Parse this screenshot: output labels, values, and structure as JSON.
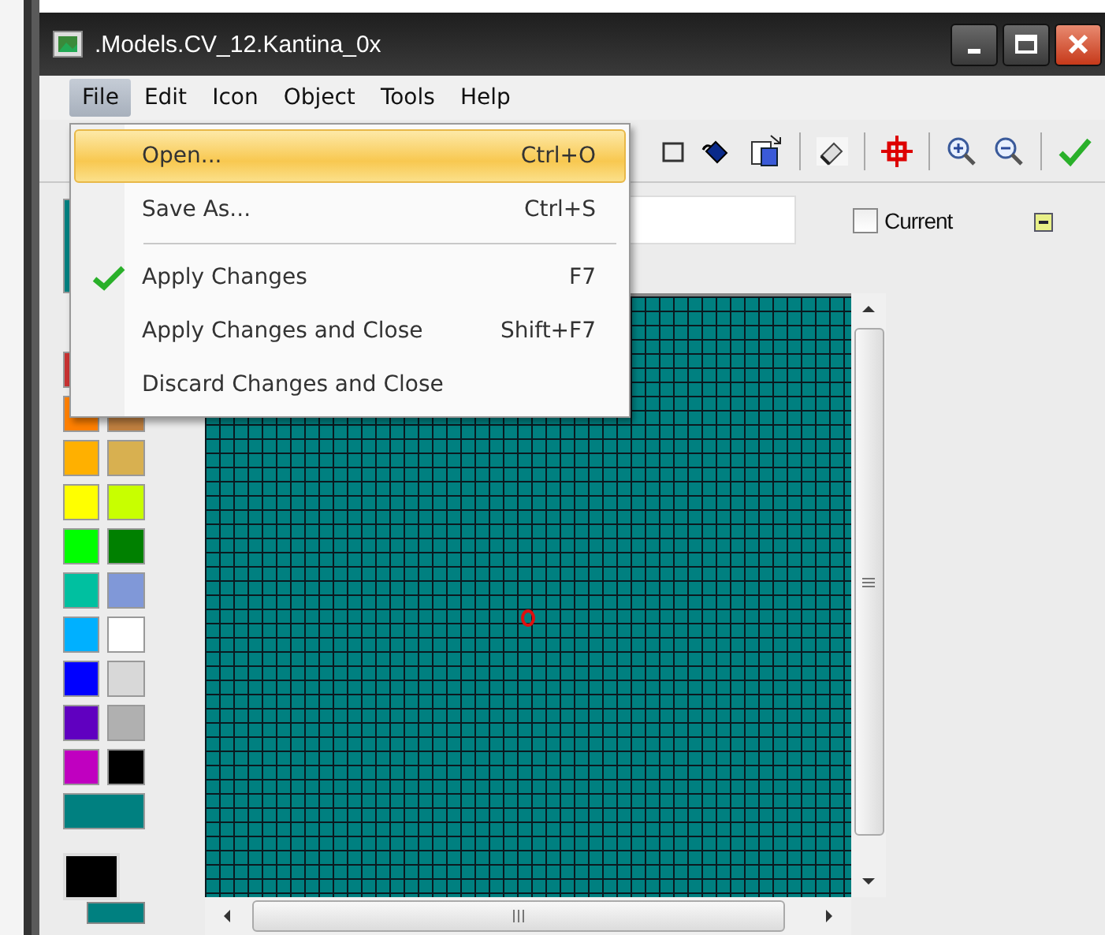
{
  "window": {
    "title": ".Models.CV_12.Kantina_0x"
  },
  "menu_bar": [
    {
      "label": "File",
      "selected": true
    },
    {
      "label": "Edit",
      "selected": false
    },
    {
      "label": "Icon",
      "selected": false
    },
    {
      "label": "Object",
      "selected": false
    },
    {
      "label": "Tools",
      "selected": false
    },
    {
      "label": "Help",
      "selected": false
    }
  ],
  "file_menu": [
    {
      "kind": "item",
      "label": "Open...",
      "shortcut": "Ctrl+O",
      "checked": false,
      "selected": true
    },
    {
      "kind": "item",
      "label": "Save As...",
      "shortcut": "Ctrl+S",
      "checked": false,
      "selected": false
    },
    {
      "kind": "separator"
    },
    {
      "kind": "item",
      "label": "Apply Changes",
      "shortcut": "F7",
      "checked": true,
      "selected": false
    },
    {
      "kind": "item",
      "label": "Apply Changes and Close",
      "shortcut": "Shift+F7",
      "checked": false,
      "selected": false
    },
    {
      "kind": "item",
      "label": "Discard Changes and Close",
      "checked": false,
      "selected": false
    }
  ],
  "current_checkbox": {
    "label": "Current",
    "checked": false
  },
  "palette": [
    {
      "kind": "tall",
      "color": "#008080"
    },
    {
      "kind": "wide",
      "color": "#c83232"
    },
    {
      "kind": "cell",
      "color": "#ff8000"
    },
    {
      "kind": "cell",
      "color": "#c08040"
    },
    {
      "kind": "cell",
      "color": "#ffb000"
    },
    {
      "kind": "cell",
      "color": "#d8b050"
    },
    {
      "kind": "cell",
      "color": "#ffff00"
    },
    {
      "kind": "cell",
      "color": "#c8ff00"
    },
    {
      "kind": "cell",
      "color": "#00ff00"
    },
    {
      "kind": "cell",
      "color": "#008000"
    },
    {
      "kind": "cell",
      "color": "#00c0a0"
    },
    {
      "kind": "cell",
      "color": "#8098d8"
    },
    {
      "kind": "cell",
      "color": "#00b0ff"
    },
    {
      "kind": "cell",
      "color": "#ffffff"
    },
    {
      "kind": "cell",
      "color": "#0000ff"
    },
    {
      "kind": "cell",
      "color": "#d8d8d8"
    },
    {
      "kind": "cell",
      "color": "#6000c0"
    },
    {
      "kind": "cell",
      "color": "#b0b0b0"
    },
    {
      "kind": "cell",
      "color": "#c000c0"
    },
    {
      "kind": "cell",
      "color": "#000000"
    },
    {
      "kind": "wide",
      "color": "#008080"
    }
  ],
  "current_colors": {
    "primary": {
      "color": "#000000"
    },
    "secondary": {
      "color": "#008080"
    }
  },
  "canvas": {
    "color": "#008080"
  }
}
